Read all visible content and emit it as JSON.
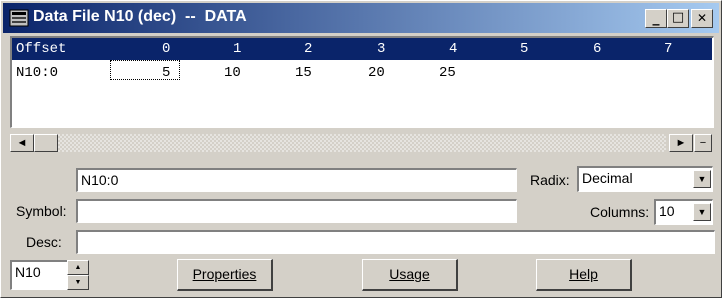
{
  "window": {
    "title": "Data File N10 (dec)  --  DATA",
    "controls": {
      "minimize": "_",
      "maximize": "□",
      "close": "✕"
    }
  },
  "grid": {
    "headers": [
      "Offset",
      "0",
      "1",
      "2",
      "3",
      "4",
      "5",
      "6",
      "7"
    ],
    "rows": [
      {
        "offset": "N10:0",
        "values": [
          "5",
          "10",
          "15",
          "20",
          "25",
          "",
          "",
          ""
        ]
      }
    ]
  },
  "scrollbar": {
    "left_arrow": "◄",
    "right_arrow": "►",
    "minus": "−"
  },
  "address_field": {
    "value": "N10:0"
  },
  "radix": {
    "label": "Radix:",
    "value": "Decimal"
  },
  "symbol": {
    "label": "Symbol:",
    "value": ""
  },
  "columns": {
    "label": "Columns:",
    "value": "10"
  },
  "desc": {
    "label": "Desc:",
    "value": ""
  },
  "file_spinner": {
    "value": "N10"
  },
  "buttons": {
    "properties": "Properties",
    "usage": "Usage",
    "help": "Help"
  },
  "icons": {
    "dropdown": "▼",
    "spin_up": "▲",
    "spin_down": "▼"
  }
}
